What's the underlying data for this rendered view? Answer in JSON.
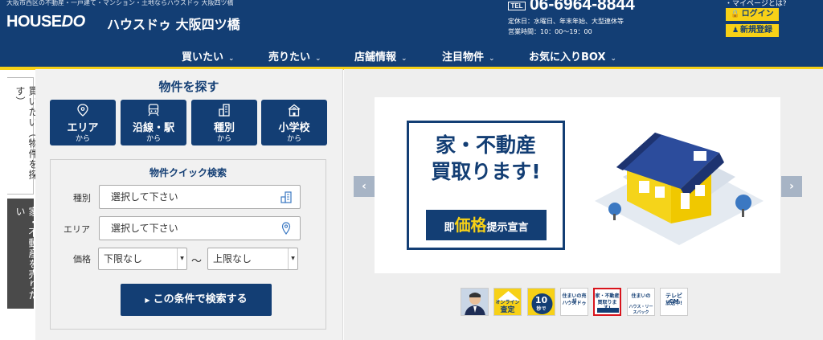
{
  "header": {
    "description": "大阪市西区の不動産・一戸建て・マンション・土地ならハウスドゥ 大阪四ツ橋",
    "logo_main": "HOUSE",
    "logo_do": "DO",
    "shop_name": "ハウスドゥ 大阪四ツ橋",
    "tel_badge": "TEL",
    "tel": "06-6964-8844",
    "holiday": "定休日：水曜日、年末年始、大型連休等",
    "hours": "営業時間：10：00〜19：00",
    "mypage_question": "・マイページとは?",
    "login": "ログイン",
    "register": "新規登録"
  },
  "nav": [
    "買いたい",
    "売りたい",
    "店舗情報",
    "注目物件",
    "お気に入りBOX"
  ],
  "side_tabs": {
    "buy": "買いたい（物件を探す）",
    "sell": "家・不動産を売りたい"
  },
  "search": {
    "title": "物件を探す",
    "categories": [
      {
        "label": "エリア",
        "sub": "から",
        "icon": "map-pin-icon"
      },
      {
        "label": "沿線・駅",
        "sub": "から",
        "icon": "train-icon"
      },
      {
        "label": "種別",
        "sub": "から",
        "icon": "building-icon"
      },
      {
        "label": "小学校",
        "sub": "から",
        "icon": "school-icon"
      }
    ],
    "quick_title": "物件クイック検索",
    "type_label": "種別",
    "type_value": "選択して下さい",
    "area_label": "エリア",
    "area_value": "選択して下さい",
    "price_label": "価格",
    "price_min": "下限なし",
    "price_tilde": "～",
    "price_max": "上限なし",
    "submit": "この条件で検索する"
  },
  "carousel": {
    "headline_1": "家・不動産",
    "headline_2": "買取ります!",
    "band_prefix": "即",
    "band_big": "価格",
    "band_suffix": "提示宣言",
    "thumbs": [
      {
        "line1": "",
        "line2": ""
      },
      {
        "line1": "オンライン",
        "line2": "査定"
      },
      {
        "line1": "10",
        "line2": "秒で"
      },
      {
        "line1": "住まいの売却",
        "line2": "ハウスドゥ"
      },
      {
        "line1": "家・不動産",
        "line2": "買取ります!"
      },
      {
        "line1": "住まいの",
        "line2": "ハウス・リースバック"
      },
      {
        "line1": "テレビCM",
        "line2": "放送中!"
      }
    ]
  },
  "colors": {
    "navy": "#133e74",
    "yellow": "#f7d117",
    "red": "#d8141c"
  }
}
